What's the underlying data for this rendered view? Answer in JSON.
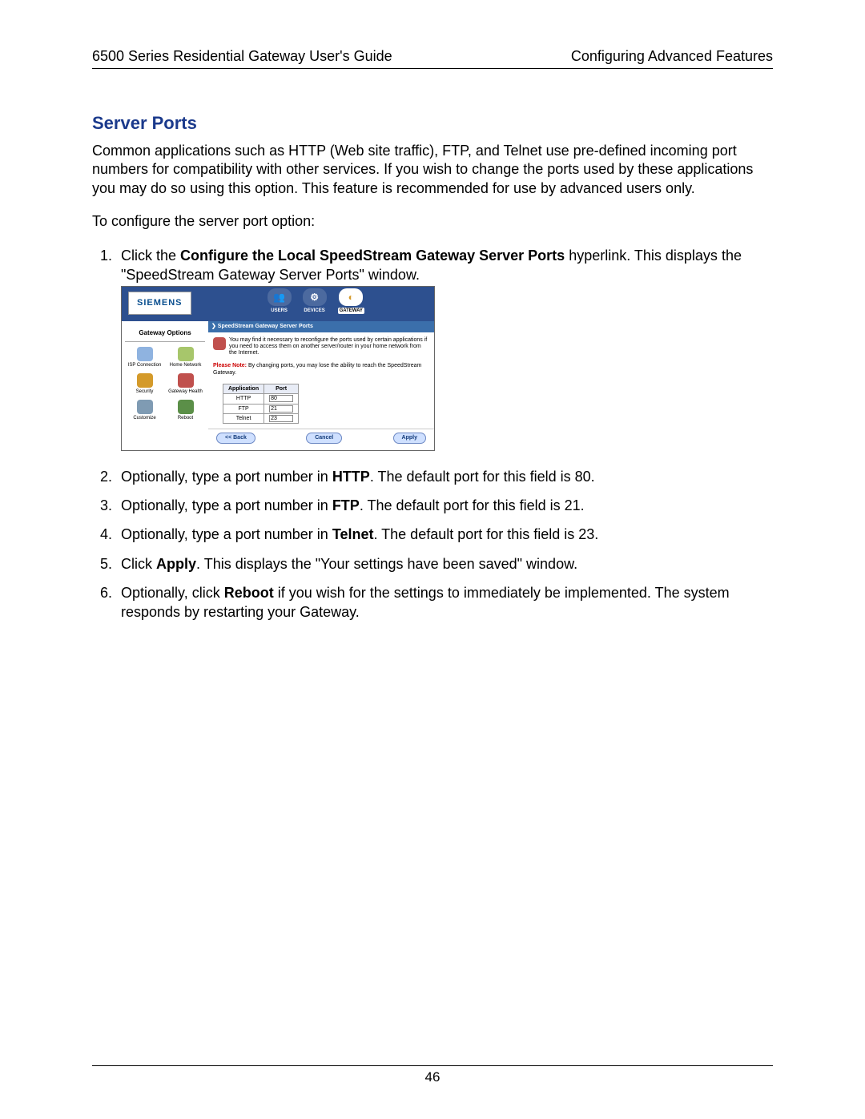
{
  "header": {
    "left": "6500 Series Residential Gateway User's Guide",
    "right": "Configuring Advanced Features"
  },
  "heading": "Server Ports",
  "intro": "Common applications such as HTTP (Web site traffic), FTP, and Telnet use pre-defined incoming port numbers for compatibility with other services. If you wish to change the ports used by these applications you may do so using this option. This feature is recommended for use by advanced users only.",
  "configure_lead": "To configure the server port option:",
  "steps": {
    "s1_pre": "Click the ",
    "s1_bold": "Configure the Local SpeedStream Gateway Server Ports",
    "s1_post": " hyperlink. This displays the \"SpeedStream Gateway Server Ports\" window.",
    "s2_pre": "Optionally, type a port number in ",
    "s2_bold": "HTTP",
    "s2_post": ". The default port for this field is 80.",
    "s3_pre": "Optionally, type a port number in ",
    "s3_bold": "FTP",
    "s3_post": ". The default port for this field is 21.",
    "s4_pre": "Optionally, type a port number in ",
    "s4_bold": "Telnet",
    "s4_post": ". The default port for this field is 23.",
    "s5_pre": "Click ",
    "s5_bold": "Apply",
    "s5_post": ". This displays the \"Your settings have been saved\" window.",
    "s6_pre": "Optionally, click ",
    "s6_bold": "Reboot",
    "s6_post": " if you wish for the settings to immediately be implemented. The system responds by restarting your Gateway."
  },
  "screenshot": {
    "brand": "SIEMENS",
    "tabs": {
      "users": "USERS",
      "devices": "DEVICES",
      "gateway": "GATEWAY"
    },
    "side_title": "Gateway Options",
    "side_items": [
      "ISP Connection",
      "Home Network",
      "Security",
      "Gateway Health",
      "Customize",
      "Reboot"
    ],
    "breadcrumb": "❯  SpeedStream Gateway Server Ports",
    "note": "You may find it necessary to reconfigure the ports used by certain applications if you need to access them on another server/router in your home network from the Internet.",
    "warn_label": "Please Note:",
    "warn_text": " By changing ports, you may lose the ability to reach the SpeedStream Gateway.",
    "table": {
      "head_app": "Application",
      "head_port": "Port",
      "rows": [
        {
          "app": "HTTP",
          "port": "80"
        },
        {
          "app": "FTP",
          "port": "21"
        },
        {
          "app": "Telnet",
          "port": "23"
        }
      ]
    },
    "buttons": {
      "back": "<< Back",
      "cancel": "Cancel",
      "apply": "Apply"
    }
  },
  "page_number": "46"
}
